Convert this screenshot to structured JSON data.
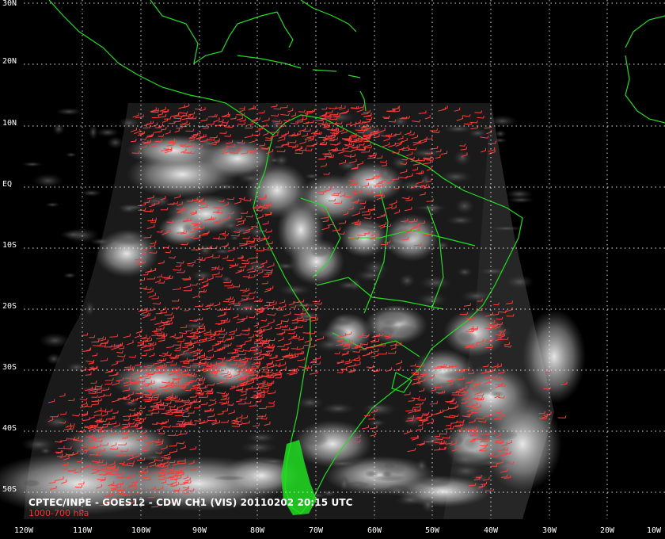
{
  "caption": "CPTEC/INPE - GOES12 - CDW CH1 (VIS) 20110202 20:15 UTC",
  "level_label": "1000-700 hPa",
  "latitude_labels": [
    "30N",
    "20N",
    "10N",
    "EQ",
    "10S",
    "20S",
    "30S",
    "40S",
    "50S"
  ],
  "longitude_labels": [
    "120W",
    "110W",
    "100W",
    "90W",
    "80W",
    "70W",
    "60W",
    "50W",
    "40W",
    "30W",
    "20W",
    "10W"
  ],
  "colors": {
    "background": "#000000",
    "coastline": "#22dd22",
    "wind_barbs": "#ff3b3b",
    "grid": "#ffffff",
    "cloud": "#e6e6e6"
  },
  "icons": {
    "wind_barbs": "wind-barb-icon",
    "coastlines": "coastline-icon"
  }
}
